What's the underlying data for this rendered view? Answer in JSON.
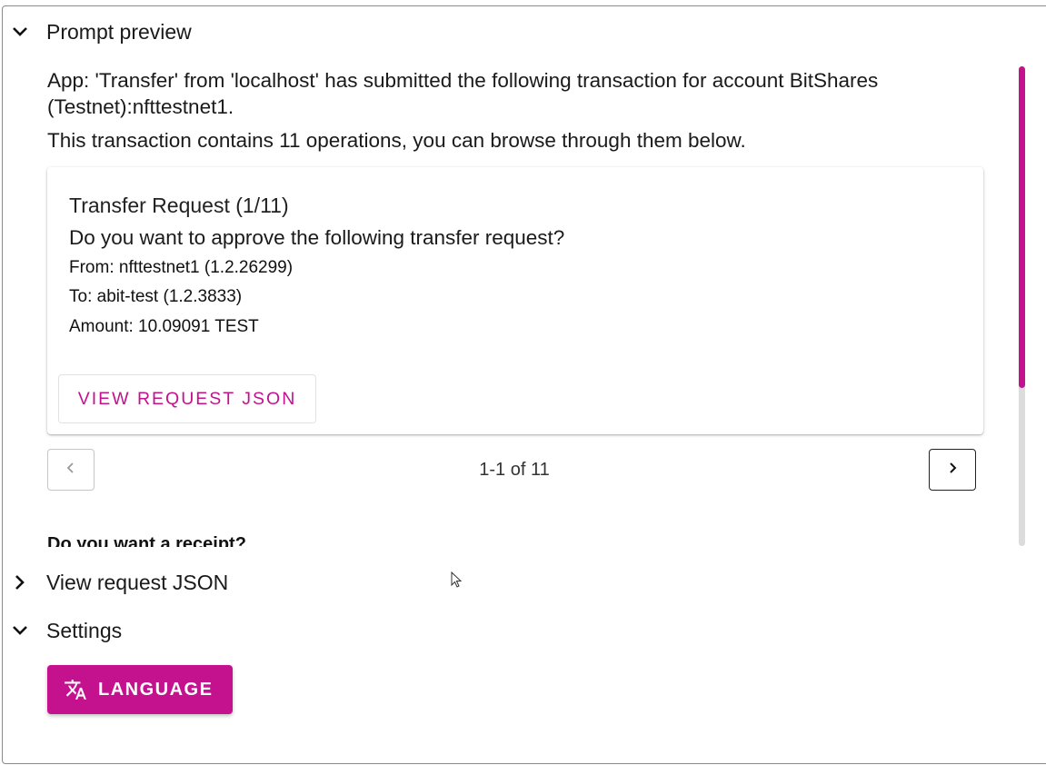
{
  "prompt_preview": {
    "header": "Prompt preview",
    "intro_line1": "App: 'Transfer' from 'localhost' has submitted the following transaction for account BitShares",
    "intro_line2": "(Testnet):nfttestnet1.",
    "ops_line": "This transaction contains 11 operations, you can browse through them below.",
    "card": {
      "title": "Transfer Request (1/11)",
      "question": "Do you want to approve the following transfer request?",
      "from": "From: nfttestnet1 (1.2.26299)",
      "to": "To: abit-test (1.2.3833)",
      "amount": "Amount: 10.09091 TEST",
      "view_json_button": "VIEW REQUEST JSON"
    },
    "pager": {
      "label": "1-1 of 11"
    },
    "receipt_question": "Do you want a receipt?"
  },
  "view_json_section": {
    "header": "View request JSON"
  },
  "settings_section": {
    "header": "Settings",
    "language_button": "LANGUAGE"
  },
  "colors": {
    "accent": "#c4128f"
  },
  "icons": {
    "collapse": "chevron-down-icon",
    "expand": "chevron-right-icon",
    "prev": "chevron-left-icon",
    "next": "chevron-right-icon",
    "language": "translate-icon"
  }
}
